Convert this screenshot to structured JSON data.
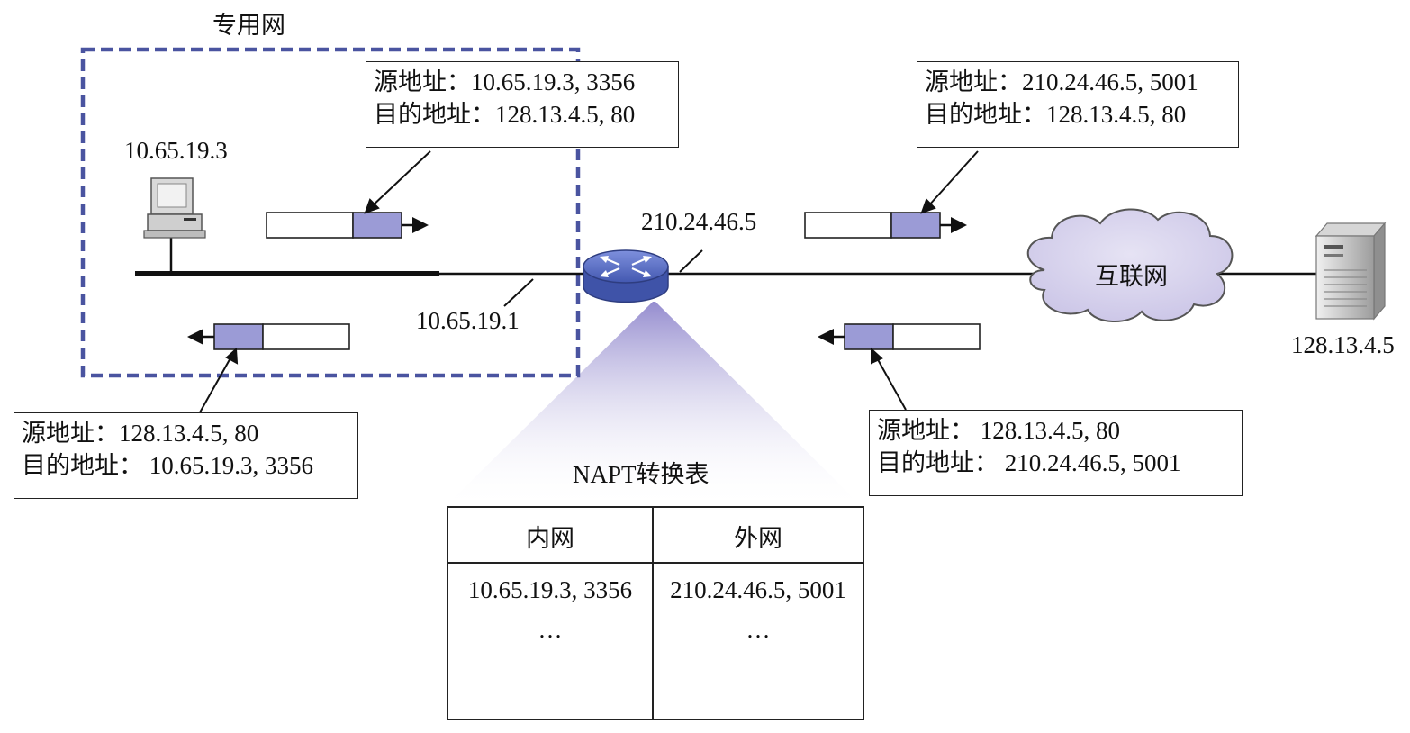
{
  "private_network": {
    "title": "专用网"
  },
  "hosts": {
    "client_ip": "10.65.19.3",
    "router_inner_ip": "10.65.19.1",
    "router_outer_ip": "210.24.46.5",
    "server_ip": "128.13.4.5"
  },
  "internet": {
    "label": "互联网"
  },
  "packets": {
    "private_out": {
      "src": "源地址：10.65.19.3, 3356",
      "dst": "目的地址：128.13.4.5, 80"
    },
    "public_out": {
      "src": "源地址：210.24.46.5, 5001",
      "dst": "目的地址：128.13.4.5, 80"
    },
    "private_in": {
      "src": "源地址：128.13.4.5, 80",
      "dst": "目的地址：  10.65.19.3, 3356"
    },
    "public_in": {
      "src": "源地址：  128.13.4.5, 80",
      "dst": "目的地址：  210.24.46.5, 5001"
    }
  },
  "napt_table": {
    "title": "NAPT转换表",
    "headers": [
      "内网",
      "外网"
    ],
    "rows": [
      [
        "10.65.19.3, 3356",
        "210.24.46.5, 5001"
      ],
      [
        "…",
        "…"
      ]
    ]
  },
  "colors": {
    "accent": "#9b9bd6",
    "border_dash": "#4a54a0",
    "cloud": "#d8d4ec",
    "router": "#5a6fc0"
  }
}
